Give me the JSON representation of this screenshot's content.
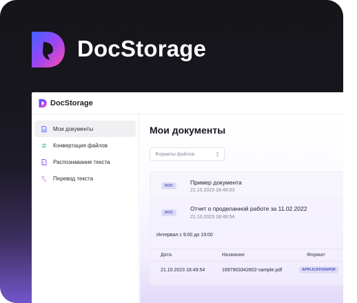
{
  "brand": {
    "name": "DocStorage",
    "app_name": "DocStorage",
    "accent": "#7b4dff"
  },
  "sidebar": {
    "items": [
      {
        "label": "Мои документы",
        "icon": "document-icon",
        "active": true
      },
      {
        "label": "Конвертация файлов",
        "icon": "convert-icon",
        "active": false
      },
      {
        "label": "Распознавание текста",
        "icon": "scan-text-icon",
        "active": false
      },
      {
        "label": "Перевод текста",
        "icon": "translate-icon",
        "active": false
      }
    ]
  },
  "main": {
    "title": "Мои документы",
    "filter_label": "Форматы файлов",
    "documents": [
      {
        "badge": "DOC",
        "name": "Пример документа",
        "date": "21.10.2023 18:49:03"
      },
      {
        "badge": "DOC",
        "name": "Отчет о проделанной работе за 11.02.2022",
        "date": "21.10.2023 18:49:54"
      }
    ],
    "interval": "Интервал с 9:00 до 19:00",
    "table": {
      "headers": [
        "Дата",
        "Название",
        "Формат"
      ],
      "rows": [
        {
          "date": "21.10.2023 18:49:54",
          "name": "1697903342802-sample.pdf",
          "format": "APPLICATION/PDF"
        }
      ]
    }
  }
}
